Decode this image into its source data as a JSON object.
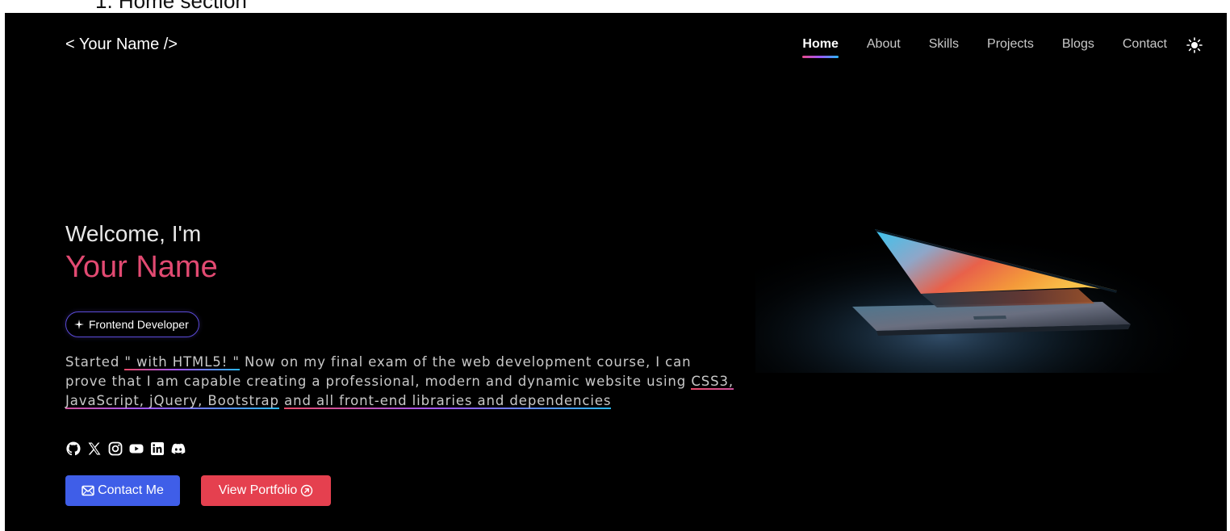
{
  "caption": "1.  Home section",
  "header": {
    "brand": "< Your Name />",
    "nav": [
      {
        "label": "Home",
        "active": true
      },
      {
        "label": "About"
      },
      {
        "label": "Skills"
      },
      {
        "label": "Projects"
      },
      {
        "label": "Blogs"
      },
      {
        "label": "Contact"
      }
    ],
    "theme_icon": "sun-icon"
  },
  "hero": {
    "greeting": "Welcome, I'm",
    "name": "Your Name",
    "role_badge": "Frontend Developer",
    "about": {
      "part1": "Started ",
      "highlight1": "\" with HTML5! \"",
      "part2": " Now on my final exam of the web development course, I can prove that I am capable creating a professional, modern and dynamic website using ",
      "highlight2": "CSS3, JavaScript, jQuery, Bootstrap",
      "part3": " ",
      "highlight3": "and all front-end libraries and dependencies"
    },
    "socials": [
      "github-icon",
      "x-icon",
      "instagram-icon",
      "youtube-icon",
      "linkedin-icon",
      "discord-icon"
    ],
    "buttons": {
      "contact": "Contact Me",
      "portfolio": "View Portfolio"
    },
    "image": "laptop-image"
  },
  "colors": {
    "background": "#000000",
    "name_accent": "#e24a72",
    "contact_button": "#3f5ee8",
    "portfolio_button": "#e5404f"
  }
}
